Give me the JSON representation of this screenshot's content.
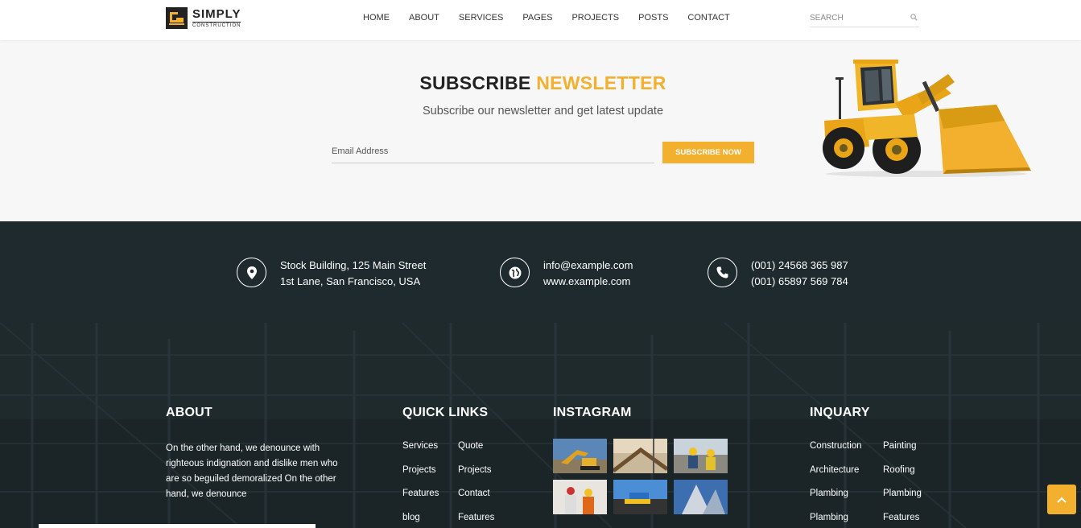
{
  "header": {
    "logo": {
      "title": "SIMPLY",
      "subtitle": "CONSTRUCTION",
      "icon": "excavator-logo-icon"
    },
    "nav": [
      "HOME",
      "ABOUT",
      "SERVICES",
      "PAGES",
      "PROJECTS",
      "POSTS",
      "CONTACT"
    ],
    "search": {
      "placeholder": "SEARCH",
      "icon": "search-icon"
    }
  },
  "newsletter": {
    "title_main": "SUBSCRIBE",
    "title_accent": "NEWSLETTER",
    "subtitle": "Subscribe our newsletter and get latest update",
    "email_placeholder": "Email Address",
    "button_label": "SUBSCRIBE NOW",
    "image": "wheel-loader-image"
  },
  "contact": {
    "address": {
      "icon": "map-pin-icon",
      "line1": "Stock Building, 125 Main Street",
      "line2": "1st Lane, San Francisco, USA"
    },
    "web": {
      "icon": "globe-icon",
      "line1": "info@example.com",
      "line2": "www.example.com"
    },
    "phone": {
      "icon": "phone-icon",
      "line1": "(001) 24568 365 987",
      "line2": "(001) 65897 569 784"
    }
  },
  "footer": {
    "about": {
      "heading": "ABOUT",
      "text": "On the other hand, we denounce with righteous indignation and dislike men who are so beguiled demoralized On the other hand, we denounce"
    },
    "quick_links": {
      "heading": "QUICK LINKS",
      "links": [
        "Services",
        "Quote",
        "Projects",
        "Projects",
        "Features",
        "Contact",
        "blog",
        "Features"
      ]
    },
    "instagram": {
      "heading": "INSTAGRAM",
      "tiles": [
        "excavator-photo",
        "bridge-construction-photo",
        "workers-site-photo",
        "engineers-photo",
        "road-paving-photo",
        "building-tower-photo"
      ]
    },
    "inquary": {
      "heading": "INQUARY",
      "links": [
        "Construction",
        "Painting",
        "Architecture",
        "Roofing",
        "Plambing",
        "Plambing",
        "Plambing",
        "Features"
      ]
    }
  },
  "colors": {
    "accent": "#f3b02e",
    "dark": "#1e2a2e",
    "text": "#222222"
  },
  "scroll_top": {
    "icon": "chevron-up-icon"
  }
}
